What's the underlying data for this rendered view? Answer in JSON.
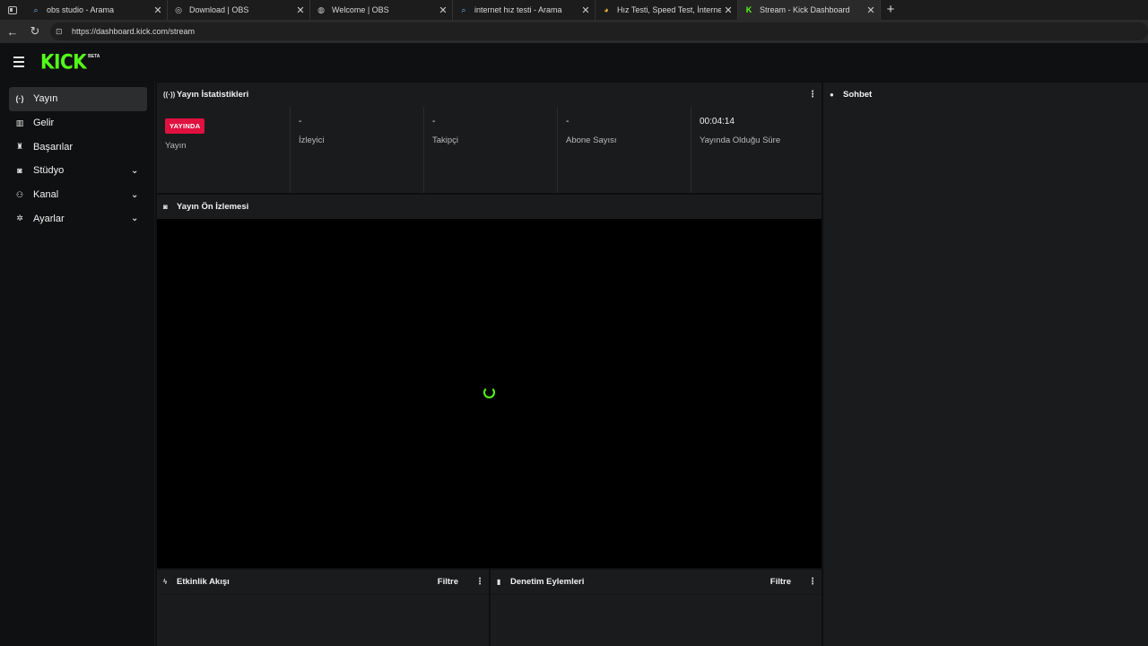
{
  "browser": {
    "tabs": [
      {
        "title": "obs studio - Arama",
        "icon": "search-icon",
        "active": false
      },
      {
        "title": "Download | OBS",
        "icon": "obs-icon",
        "active": false
      },
      {
        "title": "Welcome | OBS",
        "icon": "globe-icon",
        "active": false
      },
      {
        "title": "internet hız testi - Arama",
        "icon": "search-icon",
        "active": false
      },
      {
        "title": "Hız Testi, Speed Test, İnternet Hız",
        "icon": "speedtest-icon",
        "active": false
      },
      {
        "title": "Stream - Kick Dashboard",
        "icon": "kick-icon",
        "active": true
      }
    ],
    "new_tab": "+",
    "url": "https://dashboard.kick.com/stream"
  },
  "brand": {
    "logo_text": "KICK",
    "logo_badge": "BETA",
    "accent": "#53fc18"
  },
  "sidebar": {
    "items": [
      {
        "label": "Yayın",
        "icon": "broadcast-icon",
        "active": true,
        "expandable": false
      },
      {
        "label": "Gelir",
        "icon": "chart-icon",
        "active": false,
        "expandable": false
      },
      {
        "label": "Başarılar",
        "icon": "trophy-icon",
        "active": false,
        "expandable": false
      },
      {
        "label": "Stüdyo",
        "icon": "studio-icon",
        "active": false,
        "expandable": true
      },
      {
        "label": "Kanal",
        "icon": "users-icon",
        "active": false,
        "expandable": true
      },
      {
        "label": "Ayarlar",
        "icon": "gear-icon",
        "active": false,
        "expandable": true
      }
    ]
  },
  "stats_panel": {
    "title": "Yayın İstatistikleri",
    "status_badge": "YAYINDA",
    "status_badge_color": "#e0103f",
    "cells": [
      {
        "value": "",
        "label": "Yayın"
      },
      {
        "value": "-",
        "label": "İzleyici"
      },
      {
        "value": "-",
        "label": "Takipçi"
      },
      {
        "value": "-",
        "label": "Abone Sayısı"
      },
      {
        "value": "00:04:14",
        "label": "Yayında Olduğu Süre"
      }
    ]
  },
  "preview_panel": {
    "title": "Yayın Ön İzlemesi"
  },
  "chat_panel": {
    "title": "Sohbet"
  },
  "events_panel": {
    "title": "Etkinlik Akışı",
    "filter_label": "Filtre"
  },
  "moderation_panel": {
    "title": "Denetim Eylemleri",
    "filter_label": "Filtre"
  }
}
